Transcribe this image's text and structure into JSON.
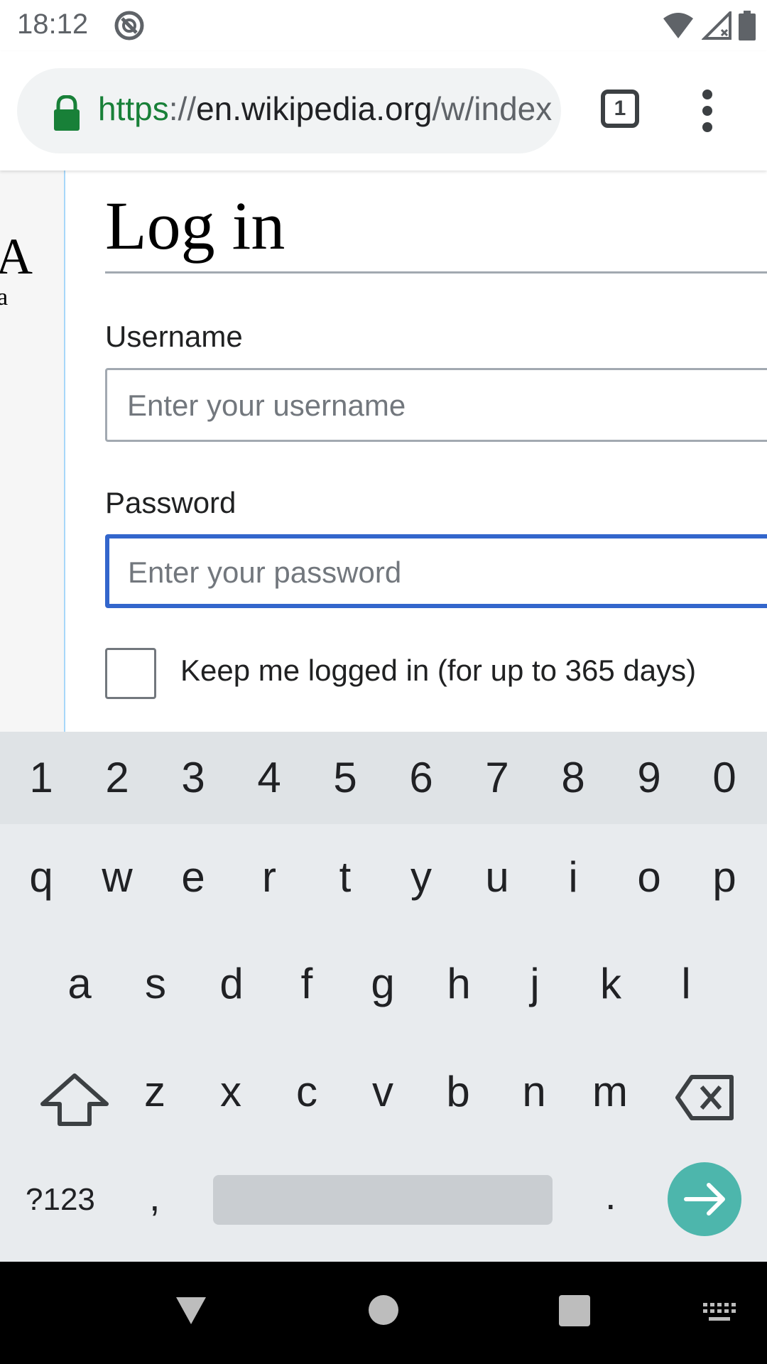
{
  "status_bar": {
    "time": "18:12"
  },
  "browser": {
    "url_scheme": "https",
    "url_sep": "://",
    "url_host": "en.wikipedia.org",
    "url_path": "/w/index.php",
    "tab_count": "1"
  },
  "page": {
    "logo_fragment": "A",
    "logo_sub_fragment": "a",
    "title": "Log in",
    "username_label": "Username",
    "username_placeholder": "Enter your username",
    "password_label": "Password",
    "password_placeholder": "Enter your password",
    "keep_logged_in_label": "Keep me logged in (for up to 365 days)"
  },
  "keyboard": {
    "number_row": [
      "1",
      "2",
      "3",
      "4",
      "5",
      "6",
      "7",
      "8",
      "9",
      "0"
    ],
    "row1": [
      "q",
      "w",
      "e",
      "r",
      "t",
      "y",
      "u",
      "i",
      "o",
      "p"
    ],
    "row2": [
      "a",
      "s",
      "d",
      "f",
      "g",
      "h",
      "j",
      "k",
      "l"
    ],
    "row3": [
      "z",
      "x",
      "c",
      "v",
      "b",
      "n",
      "m"
    ],
    "symbols_key": "?123",
    "comma_key": ",",
    "period_key": "."
  }
}
